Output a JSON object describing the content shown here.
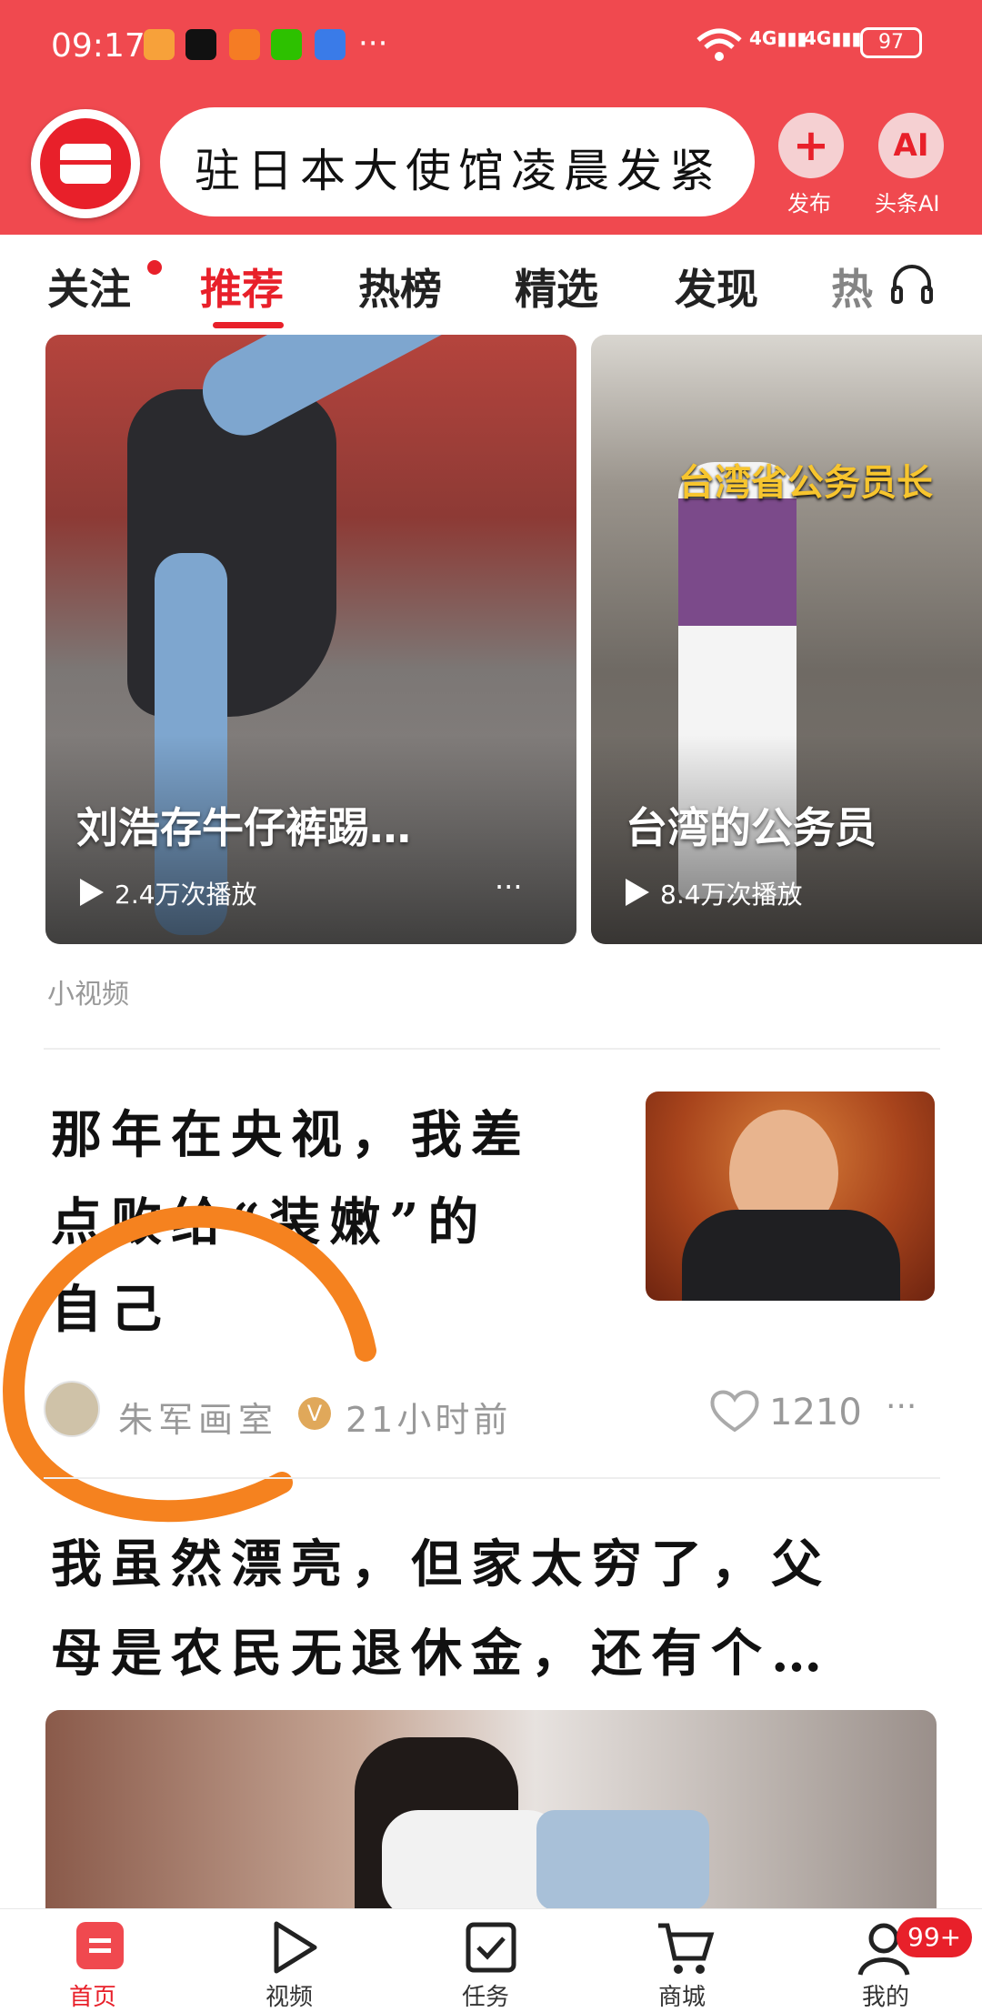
{
  "status_bar": {
    "time": "09:17",
    "more": "···",
    "network": "4G 4G",
    "battery": "97"
  },
  "header": {
    "search_text": "驻日本大使馆凌晨发紧",
    "publish_label": "发布",
    "ai_label": "头条AI",
    "ai_icon_text": "AI"
  },
  "tabs": [
    "关注",
    "推荐",
    "热榜",
    "精选",
    "发现",
    "热"
  ],
  "videos": [
    {
      "title": "刘浩存牛仔裤踢…",
      "plays": "2.4万次播放",
      "more": "···"
    },
    {
      "title": "台湾的公务员",
      "plays": "8.4万次播放",
      "overlay": "台湾省公务员长",
      "more": "···"
    }
  ],
  "small_video_label": "小视频",
  "article": {
    "title_lines": [
      "那年在央视，我差",
      "点败给“装嫩”的",
      "自己"
    ],
    "author": "朱军画室",
    "verified_mark": "V",
    "time": "21小时前",
    "likes": "1210",
    "more": "···"
  },
  "article2": {
    "title_lines": [
      "我虽然漂亮，但家太穷了，父",
      "母是农民无退休金，还有个…"
    ]
  },
  "bottom_nav": {
    "items": [
      "首页",
      "视频",
      "任务",
      "商城",
      "我的"
    ],
    "badge": "99+"
  }
}
